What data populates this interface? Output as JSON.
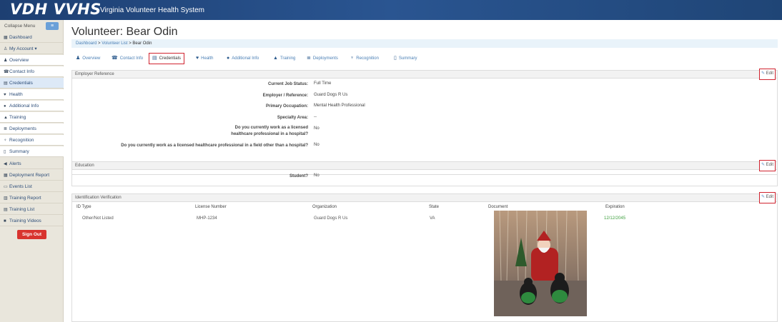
{
  "header": {
    "brand": "VDH VVHS",
    "subtitle": "Virginia Volunteer Health System"
  },
  "sidebar": {
    "collapse_label": "Collapse Menu",
    "collapse_button": "≡",
    "items": [
      {
        "label": "Dashboard",
        "icon": "dashboard-icon"
      },
      {
        "label": "My Account ▾",
        "icon": "user-icon"
      },
      {
        "label": "Overview",
        "icon": "user-icon"
      },
      {
        "label": "Contact Info",
        "icon": "phone-icon"
      },
      {
        "label": "Credentials",
        "icon": "id-card-icon"
      },
      {
        "label": "Health",
        "icon": "heart-icon"
      },
      {
        "label": "Additional Info",
        "icon": "info-icon"
      },
      {
        "label": "Training",
        "icon": "graduation-cap-icon"
      },
      {
        "label": "Deployments",
        "icon": "list-icon"
      },
      {
        "label": "Recognition",
        "icon": "trophy-icon"
      },
      {
        "label": "Summary",
        "icon": "document-icon"
      },
      {
        "label": "Alerts",
        "icon": "bullhorn-icon"
      },
      {
        "label": "Deployment Report",
        "icon": "report-icon"
      },
      {
        "label": "Events List",
        "icon": "calendar-icon"
      },
      {
        "label": "Training Report",
        "icon": "report-icon"
      },
      {
        "label": "Training List",
        "icon": "list-icon"
      },
      {
        "label": "Training Videos",
        "icon": "video-icon"
      }
    ],
    "signout": "Sign Out"
  },
  "page": {
    "title": "Volunteer: Bear Odin",
    "breadcrumb": {
      "home": "Dashboard",
      "sep": " > ",
      "list": "Volunteer List",
      "current": "Bear Odin"
    }
  },
  "tabs": [
    {
      "label": "Overview",
      "icon": "user-icon"
    },
    {
      "label": "Contact Info",
      "icon": "phone-icon"
    },
    {
      "label": "Credentials",
      "icon": "id-card-icon"
    },
    {
      "label": "Health",
      "icon": "heart-icon"
    },
    {
      "label": "Additional Info",
      "icon": "info-icon"
    },
    {
      "label": "Training",
      "icon": "graduation-cap-icon"
    },
    {
      "label": "Deployments",
      "icon": "list-icon"
    },
    {
      "label": "Recognition",
      "icon": "trophy-icon"
    },
    {
      "label": "Summary",
      "icon": "document-icon"
    }
  ],
  "employer": {
    "heading": "Employer Reference",
    "edit": "Edit",
    "rows": [
      {
        "label": "Current Job Status:",
        "value": "Full Time"
      },
      {
        "label": "Employer / Reference:",
        "value": "Guard Dogs R Us"
      },
      {
        "label": "Primary Occupation:",
        "value": "Mental Health Professional"
      },
      {
        "label": "Specialty Area:",
        "value": "--"
      },
      {
        "label": "Do you currently work as a licensed",
        "label2": "healthcare professional in a hospital?",
        "value": "No"
      },
      {
        "label": "Do you currently work as a licensed healthcare professional in a field other than a hospital?",
        "value": "No"
      }
    ]
  },
  "education": {
    "heading": "Education",
    "edit": "Edit",
    "rows": [
      {
        "label": "Student?",
        "value": "No"
      }
    ]
  },
  "identification": {
    "heading": "Identification Verification",
    "edit": "Edit",
    "columns": [
      "ID Type",
      "License Number",
      "Organization",
      "State",
      "Document",
      "Expiration"
    ],
    "rows": [
      {
        "id_type": "Other/Not Listed",
        "license": "MHP-1234",
        "organization": "Guard Dogs R Us",
        "state": "VA",
        "expiration": "12/12/2045"
      }
    ]
  },
  "colors": {
    "nav_blue": "#1d3f72",
    "link_blue": "#4a7fb5",
    "highlight_red": "#d0232f",
    "signout_red": "#d8342f",
    "expiration_green": "#3e9f3e"
  }
}
